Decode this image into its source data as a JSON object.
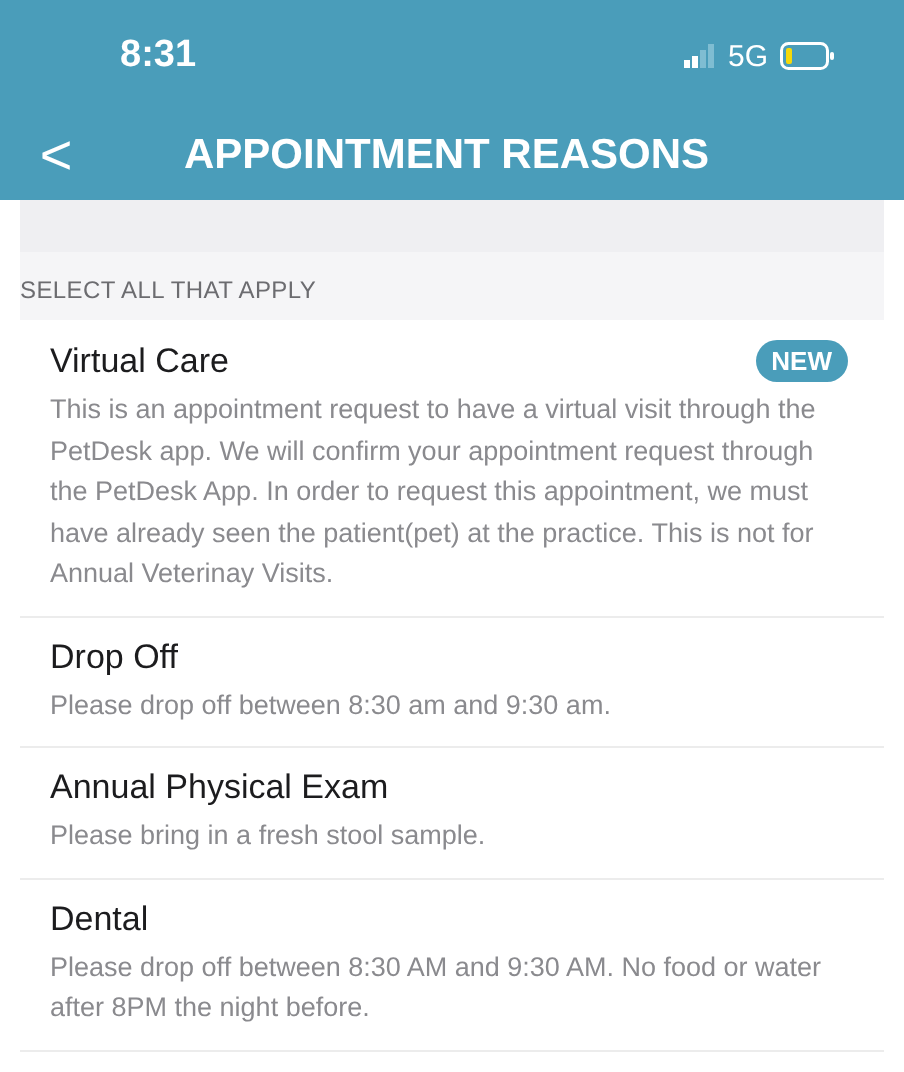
{
  "status_bar": {
    "time": "8:31",
    "network": "5G"
  },
  "header": {
    "back": "<",
    "title": "APPOINTMENT REASONS"
  },
  "section_label": "SELECT ALL THAT APPLY",
  "reasons": [
    {
      "title": "Virtual Care",
      "badge": "NEW",
      "description": "This is an appointment request to have a virtual visit through the PetDesk app. We will confirm your appointment request through the PetDesk App. In order to request this appointment, we must have already seen the patient(pet) at the practice. This is not for Annual Veterinay Visits."
    },
    {
      "title": "Drop Off",
      "description": "Please drop off between 8:30 am and 9:30 am."
    },
    {
      "title": "Annual Physical Exam",
      "description": "Please bring in a fresh stool sample."
    },
    {
      "title": "Dental",
      "description": "Please drop off between 8:30 AM and 9:30 AM. No food or water after 8PM the night before."
    }
  ]
}
